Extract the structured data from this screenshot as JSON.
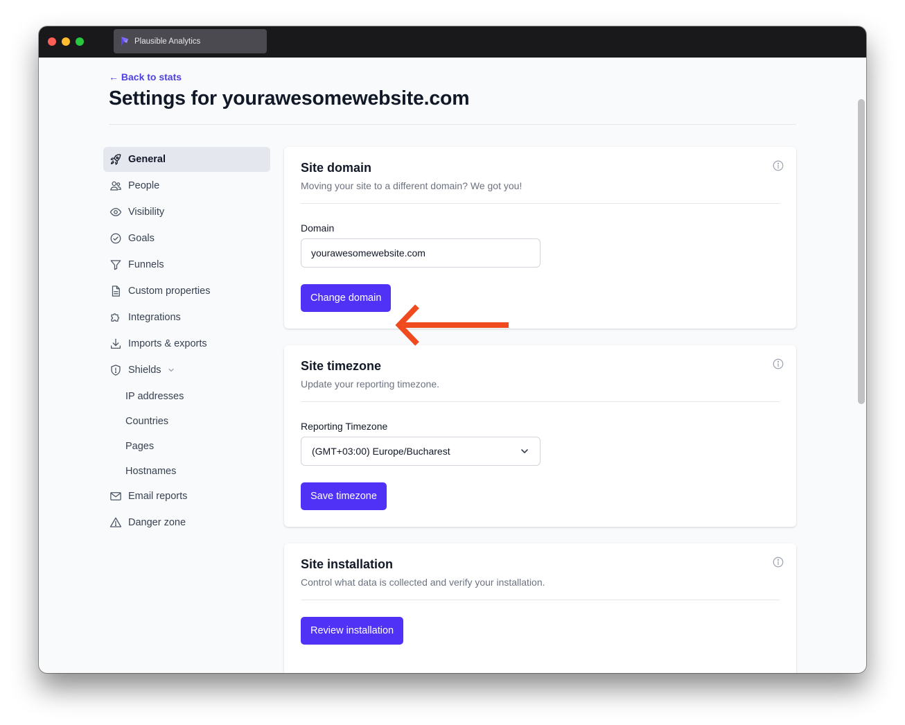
{
  "browser": {
    "tab_title": "Plausible Analytics"
  },
  "header": {
    "back_link": "← Back to stats",
    "title": "Settings for yourawesomewebsite.com"
  },
  "sidebar": {
    "items": [
      {
        "label": "General",
        "icon": "rocket-icon",
        "active": true
      },
      {
        "label": "People",
        "icon": "people-icon"
      },
      {
        "label": "Visibility",
        "icon": "eye-icon"
      },
      {
        "label": "Goals",
        "icon": "check-circle-icon"
      },
      {
        "label": "Funnels",
        "icon": "funnel-icon"
      },
      {
        "label": "Custom properties",
        "icon": "document-icon"
      },
      {
        "label": "Integrations",
        "icon": "puzzle-icon"
      },
      {
        "label": "Imports & exports",
        "icon": "download-icon"
      },
      {
        "label": "Shields",
        "icon": "shield-icon",
        "expanded": true
      },
      {
        "label": "Email reports",
        "icon": "envelope-icon"
      },
      {
        "label": "Danger zone",
        "icon": "warning-icon"
      }
    ],
    "shields_subitems": [
      "IP addresses",
      "Countries",
      "Pages",
      "Hostnames"
    ]
  },
  "site_domain": {
    "title": "Site domain",
    "subtitle": "Moving your site to a different domain? We got you!",
    "field_label": "Domain",
    "field_value": "yourawesomewebsite.com",
    "button": "Change domain"
  },
  "site_timezone": {
    "title": "Site timezone",
    "subtitle": "Update your reporting timezone.",
    "field_label": "Reporting Timezone",
    "selected": "(GMT+03:00) Europe/Bucharest",
    "button": "Save timezone"
  },
  "site_installation": {
    "title": "Site installation",
    "subtitle": "Control what data is collected and verify your installation.",
    "button": "Review installation"
  },
  "colors": {
    "accent": "#4f32f5",
    "link": "#4f3fe0",
    "annotation_arrow": "#f04a1f",
    "titlebar": "#19191c"
  }
}
